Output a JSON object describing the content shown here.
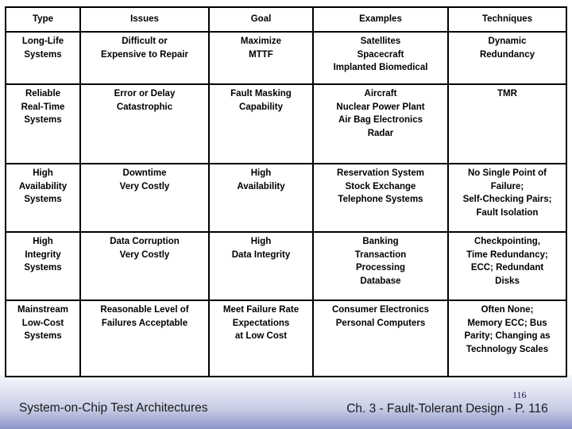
{
  "table": {
    "headers": [
      "Type",
      "Issues",
      "Goal",
      "Examples",
      "Techniques"
    ],
    "rows": [
      {
        "type": [
          "Long-Life",
          "Systems"
        ],
        "issues": [
          "Difficult or",
          "Expensive to Repair"
        ],
        "goal": [
          "Maximize",
          "MTTF"
        ],
        "examples": [
          "Satellites",
          "Spacecraft",
          "Implanted Biomedical"
        ],
        "techniques": [
          "Dynamic",
          "Redundancy"
        ],
        "techniques_align": "center"
      },
      {
        "type": [
          "Reliable",
          "Real-Time",
          "Systems"
        ],
        "issues": [
          "Error or Delay",
          "Catastrophic"
        ],
        "goal": [
          "Fault Masking",
          "Capability"
        ],
        "examples": [
          "Aircraft",
          "Nuclear Power Plant",
          "Air Bag Electronics",
          "Radar"
        ],
        "techniques": [
          "TMR"
        ],
        "techniques_align": "left"
      },
      {
        "type": [
          "High",
          "Availability",
          "Systems"
        ],
        "issues": [
          "Downtime",
          "Very Costly"
        ],
        "goal": [
          "High",
          "Availability"
        ],
        "examples": [
          "Reservation System",
          "Stock Exchange",
          "Telephone Systems"
        ],
        "techniques": [
          "No Single Point of",
          "Failure;",
          "Self-Checking Pairs;",
          "Fault Isolation"
        ],
        "techniques_align": "center"
      },
      {
        "type": [
          "High",
          "Integrity",
          "Systems"
        ],
        "issues": [
          "Data Corruption",
          "Very Costly"
        ],
        "goal": [
          "High",
          "Data Integrity"
        ],
        "examples": [
          "Banking",
          "Transaction",
          "Processing",
          "Database"
        ],
        "techniques": [
          "Checkpointing,",
          "Time Redundancy;",
          "ECC; Redundant",
          "Disks"
        ],
        "techniques_align": "center"
      },
      {
        "type": [
          "Mainstream",
          "Low-Cost",
          "Systems"
        ],
        "issues": [
          "Reasonable Level of",
          "Failures Acceptable"
        ],
        "goal": [
          "Meet Failure Rate",
          "Expectations",
          "at Low Cost"
        ],
        "examples": [
          "Consumer Electronics",
          "Personal Computers"
        ],
        "techniques": [
          "Often None;",
          "Memory ECC; Bus",
          "Parity; Changing as",
          "Technology Scales"
        ],
        "techniques_align": "center"
      }
    ]
  },
  "footer": {
    "left_text": "System-on-Chip Test Architectures",
    "right_text": "Ch. 3 - Fault-Tolerant Design - P. 116",
    "page_number": "116"
  }
}
